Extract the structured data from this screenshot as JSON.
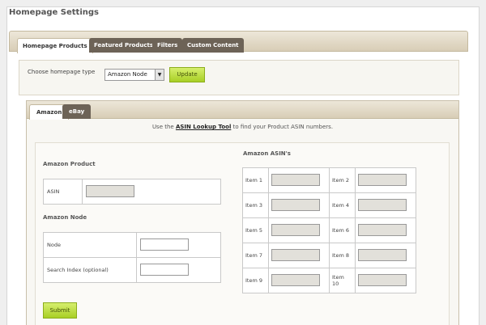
{
  "page": {
    "title": "Homepage Settings"
  },
  "top_tabs": [
    "Homepage Products",
    "Featured Products",
    "Filters",
    "Custom Content"
  ],
  "homepage_type": {
    "label": "Choose homepage type",
    "selected": "Amazon Node",
    "update_label": "Update"
  },
  "inner_tabs": [
    "Amazon",
    "eBay"
  ],
  "lookup": {
    "prefix": "Use the ",
    "link": "ASIN Lookup Tool",
    "suffix": " to find your Product ASIN numbers."
  },
  "amazon_product": {
    "title": "Amazon Product",
    "asin_label": "ASIN"
  },
  "amazon_node": {
    "title": "Amazon Node",
    "node_label": "Node",
    "search_index_label": "Search Index (optional)"
  },
  "asins": {
    "title": "Amazon ASIN's",
    "items": [
      "Item 1",
      "Item 2",
      "Item 3",
      "Item 4",
      "Item 5",
      "Item 6",
      "Item 7",
      "Item 8",
      "Item 9",
      "Item 10"
    ]
  },
  "submit_label": "Submit",
  "colors": {
    "accent_green": "#a8cf25",
    "tab_dark": "#6d6357",
    "tab_bar": "#d8cdb6"
  }
}
